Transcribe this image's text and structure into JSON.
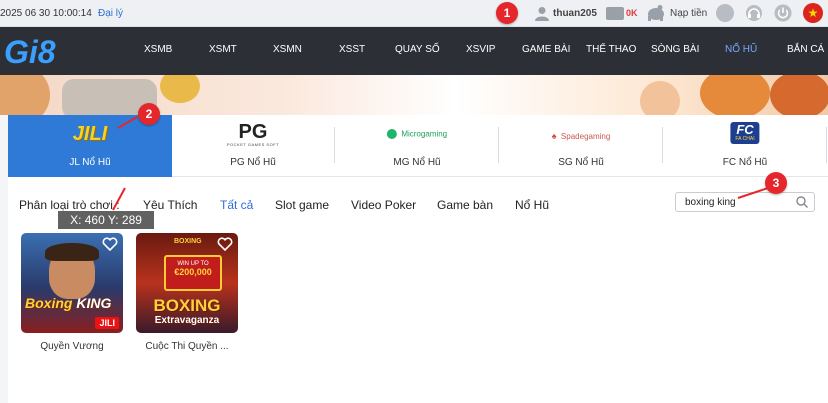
{
  "topbar": {
    "datetime": "2025 06 30 10:00:14",
    "register": "Đại lý",
    "username": "thuan205",
    "balance": "0K",
    "deposit": "Nạp tiền",
    "icons": [
      "user-icon",
      "wallet-icon",
      "deposit-icon",
      "chat-icon",
      "support-icon",
      "power-icon",
      "vietnam-flag"
    ]
  },
  "markers": [
    "1",
    "2",
    "3"
  ],
  "nav": {
    "logo": "Gi8",
    "items": [
      "XSMB",
      "XSMT",
      "XSMN",
      "XSST",
      "QUAY SỐ",
      "XSVIP",
      "GAME BÀI",
      "THỂ THAO",
      "SÒNG BÀI",
      "NỔ HŨ",
      "BẮN CÁ"
    ],
    "active": "NỔ HŨ"
  },
  "providers": [
    {
      "logo": "JILI",
      "label": "JL Nổ Hũ",
      "active": true
    },
    {
      "logo": "PG",
      "sub": "POCKET GAMES SOFT",
      "label": "PG Nổ Hũ",
      "active": false
    },
    {
      "logo": "Microgaming",
      "label": "MG Nổ Hũ",
      "active": false
    },
    {
      "logo": "Spadegaming",
      "label": "SG Nổ Hũ",
      "active": false
    },
    {
      "logo": "FC",
      "sub": "FA CHAI",
      "label": "FC Nổ Hũ",
      "active": false
    }
  ],
  "filters": {
    "title": "Phân loại trò chơi :",
    "items": [
      "Yêu Thích",
      "Tất cả",
      "Slot game",
      "Video Poker",
      "Game bàn",
      "Nổ Hũ"
    ],
    "active": "Tất cả"
  },
  "search": {
    "value": "boxing king"
  },
  "tooltip": "X: 460 Y: 289",
  "games": [
    {
      "name": "Quyền Vương",
      "art_title_1": "Boxing",
      "art_title_2": "KING",
      "badge": "JILI"
    },
    {
      "name": "Cuộc Thi Quyền ...",
      "art_title_1": "BOXING",
      "art_title_2": "Extravaganza",
      "banner": "WIN UP TO",
      "banner_amount": "€200,000",
      "top": "BOXING"
    }
  ],
  "colors": {
    "accent": "#2f7ad6",
    "nav_bg": "#2c2f36",
    "marker": "#e5262b"
  }
}
